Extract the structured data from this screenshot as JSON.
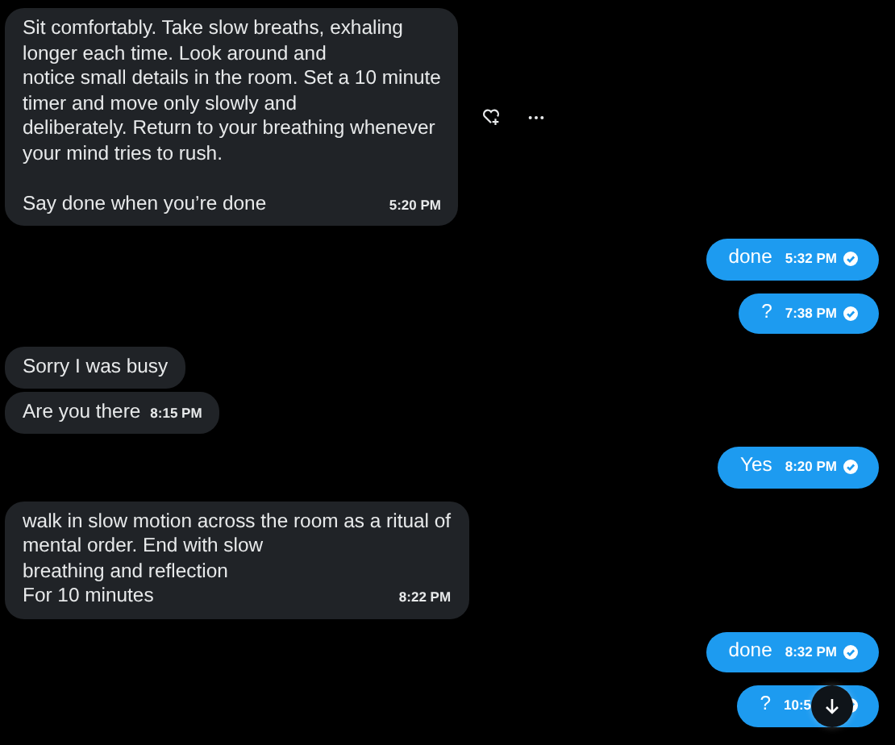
{
  "messages": [
    {
      "kind": "received",
      "paragraphs": [
        [
          "Sit comfortably. Take slow breaths, exhaling",
          "longer each time. Look around and",
          "notice small details in the room. Set a 10 minute",
          "timer and move only slowly and",
          "deliberately. Return to your breathing whenever",
          "your mind tries to rush."
        ],
        [
          "Say done when you’re done"
        ]
      ],
      "time": "5:20 PM",
      "hovered": true
    },
    {
      "kind": "sent",
      "paragraphs": [
        [
          "done"
        ]
      ],
      "time": "5:32 PM",
      "read": true
    },
    {
      "kind": "sent",
      "paragraphs": [
        [
          "?"
        ]
      ],
      "time": "7:38 PM",
      "read": true
    },
    {
      "kind": "received",
      "paragraphs": [
        [
          "Sorry I was busy"
        ]
      ]
    },
    {
      "kind": "received",
      "paragraphs": [
        [
          "Are you there"
        ]
      ],
      "time": "8:15 PM"
    },
    {
      "kind": "sent",
      "paragraphs": [
        [
          "Yes"
        ]
      ],
      "time": "8:20 PM",
      "read": true
    },
    {
      "kind": "received",
      "paragraphs": [
        [
          "walk in slow motion across the room as a ritual of",
          "mental order. End with slow",
          "breathing and reflection",
          "For 10 minutes"
        ]
      ],
      "time": "8:22 PM"
    },
    {
      "kind": "sent",
      "paragraphs": [
        [
          "done"
        ]
      ],
      "time": "8:32 PM",
      "read": true
    },
    {
      "kind": "sent",
      "paragraphs": [
        [
          "?"
        ]
      ],
      "time": "10:5",
      "read": true
    }
  ]
}
